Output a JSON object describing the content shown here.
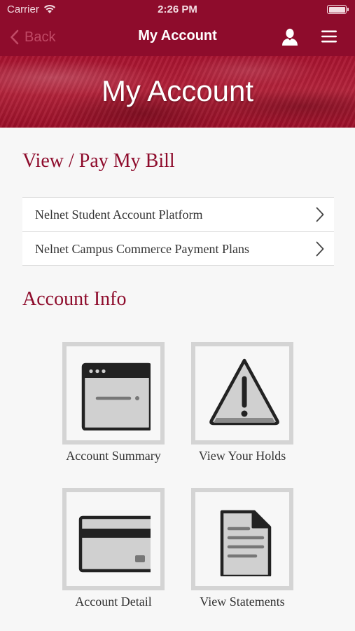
{
  "status_bar": {
    "carrier": "Carrier",
    "time": "2:26 PM"
  },
  "nav": {
    "back_label": "Back",
    "title": "My Account",
    "icons": [
      "chevron-left-icon",
      "user-icon",
      "menu-icon"
    ]
  },
  "banner": {
    "title": "My Account"
  },
  "bill_section": {
    "heading": "View / Pay My Bill",
    "links": [
      {
        "label": "Nelnet Student Account Platform"
      },
      {
        "label": "Nelnet Campus Commerce Payment Plans"
      }
    ]
  },
  "account_info": {
    "heading": "Account Info",
    "tiles": [
      {
        "label": "Account Summary",
        "icon": "browser-window-icon"
      },
      {
        "label": "View Your Holds",
        "icon": "warning-icon"
      },
      {
        "label": "Account Detail",
        "icon": "credit-card-icon"
      },
      {
        "label": "View Statements",
        "icon": "document-icon"
      }
    ]
  },
  "colors": {
    "brand": "#8e0c2c",
    "banner": "#a8122f",
    "tile_border": "#d4d4d4",
    "background": "#f7f7f7"
  }
}
